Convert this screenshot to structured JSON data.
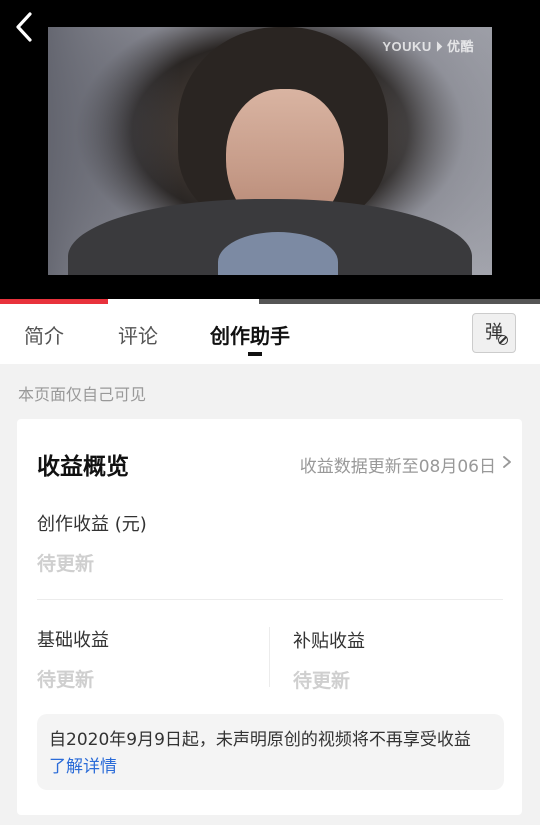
{
  "video": {
    "watermark": "YOUKU ⏵ 优酷",
    "progress_played": 0.2,
    "progress_buffered": 0.48
  },
  "tabs": [
    {
      "label": "简介"
    },
    {
      "label": "评论"
    },
    {
      "label": "创作助手"
    }
  ],
  "danmu_label": "弹",
  "note": "本页面仅自己可见",
  "income": {
    "title": "收益概览",
    "update_text": "收益数据更新至08月06日",
    "creation_label": "创作收益 (元)",
    "creation_value": "待更新",
    "basic_label": "基础收益",
    "basic_value": "待更新",
    "subsidy_label": "补贴收益",
    "subsidy_value": "待更新",
    "notice_text": "自2020年9月9日起，未声明原创的视频将不再享受收益",
    "notice_link": "了解详情"
  },
  "colors": {
    "accent": "#e8323c",
    "link": "#2a6bd8"
  }
}
